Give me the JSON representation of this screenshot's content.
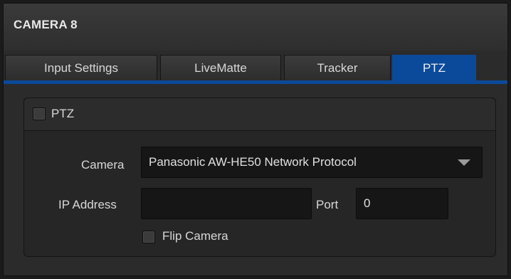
{
  "window": {
    "title": "CAMERA 8"
  },
  "tabs": [
    {
      "label": "Input Settings"
    },
    {
      "label": "LiveMatte"
    },
    {
      "label": "Tracker"
    },
    {
      "label": "PTZ",
      "active": true
    }
  ],
  "ptz_section": {
    "enable_label": "PTZ",
    "enabled": false,
    "camera_label": "Camera",
    "camera_value": "Panasonic AW-HE50 Network Protocol",
    "ip_label": "IP Address",
    "ip_value": "",
    "port_label": "Port",
    "port_value": "0",
    "flip_label": "Flip Camera",
    "flip_checked": false
  },
  "colors": {
    "accent": "#0b4a9a",
    "background": "#2b2b2b"
  }
}
